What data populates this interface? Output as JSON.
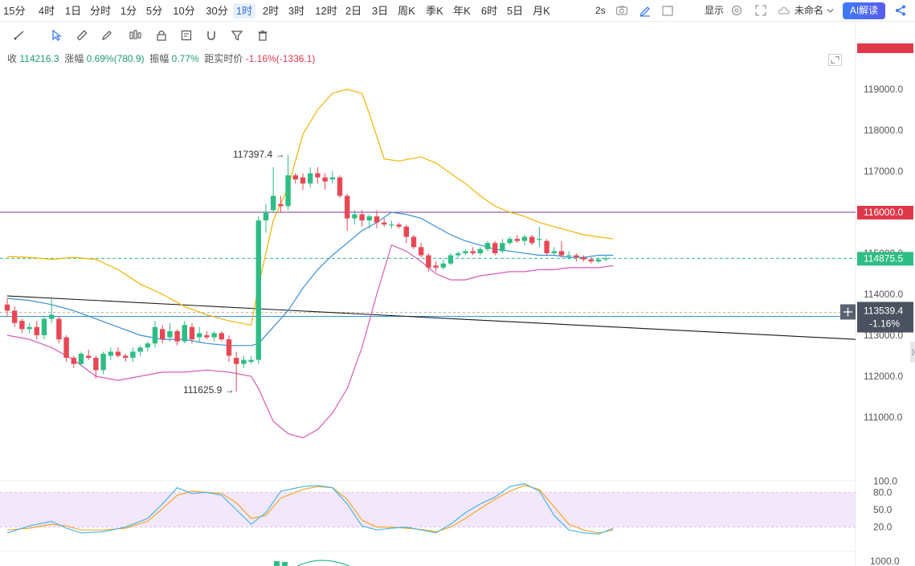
{
  "timeframes": [
    "15分",
    "4时",
    "1日",
    "分时",
    "1分",
    "5分",
    "10分",
    "30分",
    "1时",
    "2时",
    "3时",
    "12时",
    "2日",
    "3日",
    "周K",
    "季K",
    "年K",
    "6时",
    "5日",
    "月K"
  ],
  "active_timeframe": "1时",
  "toolbar_right": {
    "refresh": "2s",
    "display_label": "显示",
    "layout_name": "未命名",
    "ai_label": "AI解读"
  },
  "drawing_tools": [
    "trend-line-icon",
    "select-icon",
    "ruler-icon",
    "pencil-icon",
    "candles-icon",
    "lock-icon",
    "note-icon",
    "magnet-icon",
    "filter-icon",
    "delete-icon"
  ],
  "info_bar": {
    "close_label": "收",
    "close_value": "114216.3",
    "change_label": "涨幅",
    "change_value": "0.69%(780.9)",
    "amplitude_label": "振幅",
    "amplitude_value": "0.77%",
    "distance_label": "距实时价",
    "distance_value": "-1.16%(-1336.1)"
  },
  "colors": {
    "up": "#2ebd85",
    "down": "#e84855",
    "boll_upper": "#f0b400",
    "boll_mid": "#3a8fd8",
    "boll_lower": "#d75cb5",
    "kdj_k": "#48b6e6",
    "kdj_d": "#f5a623",
    "horizontal_line": "#7c3a8e",
    "trend_line": "#1a1a1a"
  },
  "chart_data": {
    "type": "candlestick",
    "interval": "1时",
    "y_axis_ticks": [
      111000.0,
      112000.0,
      113000.0,
      114000.0,
      115000.0,
      116000.0,
      117000.0,
      118000.0,
      119000.0
    ],
    "y_axis_labels": [
      "111000.0",
      "112000.0",
      "113000.0",
      "114000.0",
      "115000.0",
      "116000.0",
      "117000.0",
      "118000.0",
      "119000.0"
    ],
    "high_annotation": "117397.4",
    "low_annotation": "111625.9",
    "price_labels": {
      "horizontal_level": "116000.0",
      "last_price": "114875.5",
      "crosshair_price": "113539.4",
      "crosshair_change": "-1.16%"
    },
    "price_levels": {
      "horizontal_level": 116000.0,
      "last_price": 114875.5,
      "crosshair_price": 113539.4
    },
    "trend_line": [
      [
        0,
        113960
      ],
      [
        86,
        112900
      ]
    ],
    "candles": [
      [
        113750,
        113600,
        113900,
        113450
      ],
      [
        113600,
        113300,
        113700,
        113200
      ],
      [
        113350,
        113150,
        113400,
        113050
      ],
      [
        113150,
        113200,
        113300,
        113050
      ],
      [
        113200,
        113000,
        113350,
        112900
      ],
      [
        113000,
        113400,
        113450,
        112900
      ],
      [
        113400,
        113500,
        113900,
        113300
      ],
      [
        113400,
        112900,
        113450,
        112800
      ],
      [
        112950,
        112450,
        113000,
        112350
      ],
      [
        112450,
        112300,
        112500,
        112200
      ],
      [
        112300,
        112550,
        112600,
        112250
      ],
      [
        112500,
        112450,
        112650,
        112400
      ],
      [
        112450,
        112150,
        112500,
        111950
      ],
      [
        112150,
        112550,
        112600,
        112050
      ],
      [
        112500,
        112600,
        112700,
        112400
      ],
      [
        112600,
        112500,
        112700,
        112450
      ],
      [
        112500,
        112450,
        112550,
        112350
      ],
      [
        112450,
        112600,
        112700,
        112350
      ],
      [
        112600,
        112700,
        112750,
        112500
      ],
      [
        112700,
        112800,
        112850,
        112600
      ],
      [
        112800,
        113200,
        113350,
        112700
      ],
      [
        113150,
        112900,
        113250,
        112800
      ],
      [
        112950,
        113100,
        113300,
        112850
      ],
      [
        113100,
        112850,
        113150,
        112750
      ],
      [
        112850,
        113250,
        113350,
        112800
      ],
      [
        113200,
        112900,
        113300,
        112800
      ],
      [
        112950,
        113050,
        113200,
        112850
      ],
      [
        113000,
        112950,
        113100,
        112900
      ],
      [
        112950,
        113050,
        113100,
        112850
      ],
      [
        113050,
        112900,
        113100,
        112850
      ],
      [
        112900,
        112500,
        113000,
        112350
      ],
      [
        112450,
        112300,
        112600,
        111625.9
      ],
      [
        112300,
        112400,
        112500,
        112200
      ],
      [
        112350,
        112400,
        112500,
        112300
      ],
      [
        112400,
        115800,
        115900,
        112300
      ],
      [
        115800,
        116000,
        116200,
        115500
      ],
      [
        116050,
        116400,
        117100,
        116000
      ],
      [
        116200,
        116150,
        116400,
        116000
      ],
      [
        116150,
        116900,
        117397.4,
        116050
      ],
      [
        116900,
        116800,
        116950,
        116700
      ],
      [
        116850,
        116700,
        116950,
        116550
      ],
      [
        116700,
        116950,
        117100,
        116600
      ],
      [
        116950,
        116850,
        117100,
        116700
      ],
      [
        116850,
        116750,
        116950,
        116550
      ],
      [
        116800,
        116850,
        117000,
        116700
      ],
      [
        116850,
        116400,
        116900,
        116350
      ],
      [
        116400,
        115850,
        116450,
        115550
      ],
      [
        115850,
        115950,
        116050,
        115700
      ],
      [
        115950,
        115800,
        116050,
        115650
      ],
      [
        115800,
        115900,
        115950,
        115600
      ],
      [
        115900,
        115750,
        116050,
        115600
      ],
      [
        115750,
        115700,
        115850,
        115650
      ],
      [
        115700,
        115700,
        115800,
        115600
      ],
      [
        115700,
        115650,
        115750,
        115600
      ],
      [
        115650,
        115400,
        115700,
        115250
      ],
      [
        115400,
        115150,
        115450,
        115100
      ],
      [
        115150,
        114950,
        115250,
        114900
      ],
      [
        114950,
        114650,
        115000,
        114550
      ],
      [
        114700,
        114650,
        114800,
        114550
      ],
      [
        114650,
        114750,
        114850,
        114600
      ],
      [
        114750,
        114950,
        115000,
        114700
      ],
      [
        114950,
        115000,
        115050,
        114900
      ],
      [
        115000,
        115050,
        115100,
        114950
      ],
      [
        115050,
        115000,
        115150,
        114950
      ],
      [
        115000,
        115100,
        115150,
        114950
      ],
      [
        115100,
        115250,
        115300,
        115050
      ],
      [
        115250,
        115000,
        115300,
        114950
      ],
      [
        115050,
        115250,
        115350,
        115000
      ],
      [
        115250,
        115350,
        115400,
        115200
      ],
      [
        115350,
        115300,
        115450,
        115250
      ],
      [
        115300,
        115400,
        115450,
        115200
      ],
      [
        115400,
        115250,
        115450,
        115200
      ],
      [
        115350,
        115350,
        115650,
        115150
      ],
      [
        115300,
        115000,
        115350,
        114950
      ],
      [
        115000,
        115050,
        115150,
        114950
      ],
      [
        115050,
        114950,
        115300,
        114900
      ],
      [
        114950,
        114950,
        115050,
        114850
      ],
      [
        114950,
        114900,
        115000,
        114800
      ],
      [
        114900,
        114850,
        114950,
        114800
      ],
      [
        114850,
        114800,
        114900,
        114750
      ],
      [
        114800,
        114850,
        114900,
        114750
      ],
      [
        114850,
        114875.5,
        114950,
        114800
      ]
    ],
    "bollinger": {
      "upper_points": [
        [
          0,
          114920
        ],
        [
          3,
          114900
        ],
        [
          6,
          114850
        ],
        [
          9,
          114900
        ],
        [
          12,
          114850
        ],
        [
          15,
          114600
        ],
        [
          18,
          114250
        ],
        [
          21,
          114000
        ],
        [
          24,
          113700
        ],
        [
          27,
          113500
        ],
        [
          30,
          113350
        ],
        [
          33,
          113250
        ],
        [
          34,
          114200
        ],
        [
          36,
          115800
        ],
        [
          38,
          116600
        ],
        [
          40,
          117900
        ],
        [
          42,
          118500
        ],
        [
          44,
          118900
        ],
        [
          46,
          119000
        ],
        [
          48,
          118900
        ],
        [
          49,
          118400
        ],
        [
          51,
          117300
        ],
        [
          53,
          117250
        ],
        [
          56,
          117350
        ],
        [
          58,
          117200
        ],
        [
          60,
          116950
        ],
        [
          62,
          116700
        ],
        [
          64,
          116400
        ],
        [
          66,
          116150
        ],
        [
          68,
          116000
        ],
        [
          70,
          115900
        ],
        [
          72,
          115750
        ],
        [
          74,
          115650
        ],
        [
          76,
          115550
        ],
        [
          78,
          115450
        ],
        [
          80,
          115400
        ],
        [
          82,
          115350
        ]
      ],
      "mid_points": [
        [
          0,
          113900
        ],
        [
          3,
          113850
        ],
        [
          6,
          113750
        ],
        [
          9,
          113600
        ],
        [
          12,
          113400
        ],
        [
          15,
          113200
        ],
        [
          18,
          113000
        ],
        [
          21,
          112900
        ],
        [
          24,
          112900
        ],
        [
          27,
          112800
        ],
        [
          30,
          112750
        ],
        [
          33,
          112750
        ],
        [
          34,
          112800
        ],
        [
          36,
          113200
        ],
        [
          38,
          113600
        ],
        [
          40,
          114150
        ],
        [
          42,
          114600
        ],
        [
          44,
          114950
        ],
        [
          46,
          115250
        ],
        [
          48,
          115550
        ],
        [
          50,
          115750
        ],
        [
          52,
          116000
        ],
        [
          54,
          115950
        ],
        [
          56,
          115850
        ],
        [
          58,
          115650
        ],
        [
          60,
          115450
        ],
        [
          62,
          115300
        ],
        [
          64,
          115200
        ],
        [
          66,
          115100
        ],
        [
          68,
          115050
        ],
        [
          70,
          115000
        ],
        [
          72,
          114950
        ],
        [
          74,
          114950
        ],
        [
          76,
          114900
        ],
        [
          78,
          114900
        ],
        [
          80,
          114950
        ],
        [
          82,
          114950
        ]
      ],
      "lower_points": [
        [
          0,
          113000
        ],
        [
          3,
          112900
        ],
        [
          6,
          112700
        ],
        [
          9,
          112400
        ],
        [
          12,
          112000
        ],
        [
          15,
          111900
        ],
        [
          18,
          112000
        ],
        [
          21,
          112100
        ],
        [
          24,
          112100
        ],
        [
          27,
          112150
        ],
        [
          30,
          112100
        ],
        [
          33,
          112000
        ],
        [
          34,
          111700
        ],
        [
          36,
          110900
        ],
        [
          38,
          110600
        ],
        [
          40,
          110500
        ],
        [
          42,
          110700
        ],
        [
          44,
          111100
        ],
        [
          46,
          111700
        ],
        [
          48,
          112700
        ],
        [
          50,
          114000
        ],
        [
          52,
          115200
        ],
        [
          54,
          115050
        ],
        [
          56,
          114800
        ],
        [
          58,
          114500
        ],
        [
          60,
          114350
        ],
        [
          62,
          114350
        ],
        [
          64,
          114450
        ],
        [
          66,
          114500
        ],
        [
          68,
          114550
        ],
        [
          70,
          114550
        ],
        [
          72,
          114600
        ],
        [
          74,
          114600
        ],
        [
          76,
          114650
        ],
        [
          78,
          114650
        ],
        [
          80,
          114650
        ],
        [
          82,
          114700
        ]
      ]
    },
    "kdj": {
      "y_axis_labels": [
        "100.0",
        "80.0",
        "50.0",
        "20.0"
      ],
      "band": [
        20,
        80
      ],
      "ylim": [
        0,
        100
      ],
      "k_points": [
        [
          0,
          10
        ],
        [
          3,
          22
        ],
        [
          6,
          30
        ],
        [
          8,
          18
        ],
        [
          10,
          10
        ],
        [
          13,
          12
        ],
        [
          16,
          20
        ],
        [
          19,
          35
        ],
        [
          21,
          60
        ],
        [
          23,
          88
        ],
        [
          25,
          78
        ],
        [
          27,
          80
        ],
        [
          29,
          75
        ],
        [
          31,
          50
        ],
        [
          33,
          25
        ],
        [
          35,
          45
        ],
        [
          37,
          82
        ],
        [
          40,
          90
        ],
        [
          42,
          92
        ],
        [
          44,
          88
        ],
        [
          46,
          60
        ],
        [
          48,
          22
        ],
        [
          50,
          15
        ],
        [
          52,
          18
        ],
        [
          54,
          20
        ],
        [
          56,
          15
        ],
        [
          58,
          10
        ],
        [
          60,
          25
        ],
        [
          62,
          45
        ],
        [
          64,
          60
        ],
        [
          66,
          72
        ],
        [
          68,
          90
        ],
        [
          70,
          95
        ],
        [
          72,
          82
        ],
        [
          74,
          40
        ],
        [
          76,
          15
        ],
        [
          78,
          10
        ],
        [
          80,
          8
        ],
        [
          82,
          18
        ]
      ],
      "d_points": [
        [
          0,
          15
        ],
        [
          3,
          18
        ],
        [
          6,
          25
        ],
        [
          8,
          22
        ],
        [
          10,
          15
        ],
        [
          13,
          15
        ],
        [
          16,
          18
        ],
        [
          19,
          30
        ],
        [
          21,
          52
        ],
        [
          23,
          75
        ],
        [
          25,
          82
        ],
        [
          27,
          80
        ],
        [
          29,
          78
        ],
        [
          31,
          62
        ],
        [
          33,
          35
        ],
        [
          35,
          40
        ],
        [
          37,
          70
        ],
        [
          40,
          85
        ],
        [
          42,
          90
        ],
        [
          44,
          88
        ],
        [
          46,
          68
        ],
        [
          48,
          32
        ],
        [
          50,
          20
        ],
        [
          52,
          20
        ],
        [
          54,
          18
        ],
        [
          56,
          16
        ],
        [
          58,
          12
        ],
        [
          60,
          20
        ],
        [
          62,
          35
        ],
        [
          64,
          52
        ],
        [
          66,
          68
        ],
        [
          68,
          82
        ],
        [
          70,
          92
        ],
        [
          72,
          85
        ],
        [
          74,
          55
        ],
        [
          76,
          25
        ],
        [
          78,
          15
        ],
        [
          80,
          10
        ],
        [
          82,
          15
        ]
      ]
    },
    "volume_axis_label": "1000.0"
  }
}
